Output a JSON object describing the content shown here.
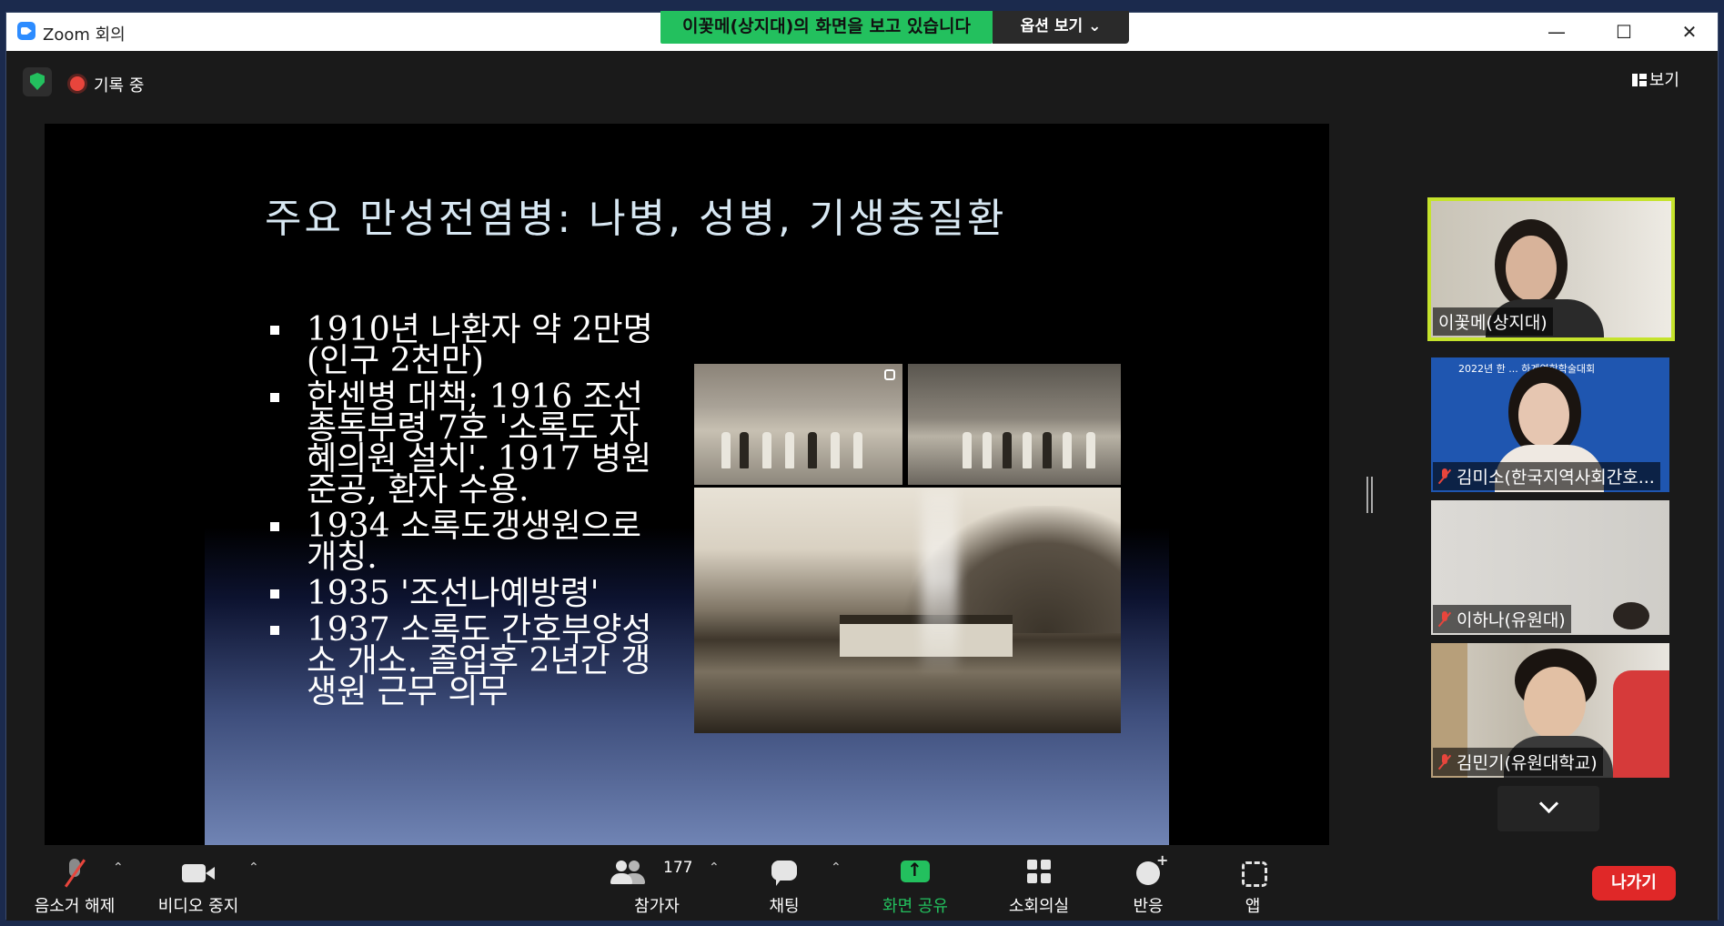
{
  "window": {
    "app_title": "Zoom 회의",
    "controls": [
      "—",
      "☐",
      "✕"
    ]
  },
  "share_banner": {
    "text": "이꽃메(상지대)의 화면을 보고 있습니다",
    "view_options": "옵션 보기 ⌄",
    "accent_color": "#23c05e"
  },
  "status": {
    "recording_label": "기록 중",
    "view_label": "보기"
  },
  "slide": {
    "title": "주요 만성전염병: 나병, 성병, 기생충질환",
    "bullets": [
      "1910년 나환자 약 2만명 (인구 2천만)",
      "한센병 대책; 1916 조선 총독부령 7호 '소록도 자혜의원 설치'. 1917 병원 준공, 환자 수용.",
      "1934 소록도갱생원으로 개칭.",
      "1935 '조선나예방령'",
      "1937 소록도 간호부양성소 개소. 졸업후 2년간 갱생원 근무 의무"
    ]
  },
  "participants": [
    {
      "name": "이꽃메(상지대)",
      "muted": false,
      "active": true
    },
    {
      "name": "김미소(한국지역사회간호...",
      "muted": true,
      "active": false,
      "banner_text": "2022년 한 ... 하계연합학술대회"
    },
    {
      "name": "이하나(유원대)",
      "muted": true,
      "active": false
    },
    {
      "name": "김민기(유원대학교)",
      "muted": true,
      "active": false
    }
  ],
  "toolbar": {
    "unmute": "음소거 해제",
    "stop_video": "비디오 중지",
    "participants": "참가자",
    "participants_count": "177",
    "chat": "채팅",
    "share_screen": "화면 공유",
    "breakout_rooms": "소회의실",
    "reactions": "반응",
    "apps": "앱",
    "leave": "나가기",
    "leave_color": "#e02828"
  }
}
